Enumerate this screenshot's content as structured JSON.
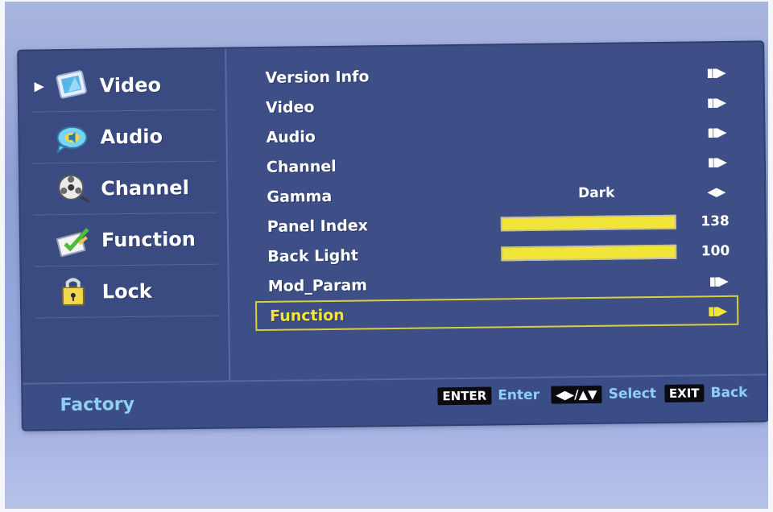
{
  "sidebar": {
    "items": [
      {
        "label": "Video",
        "icon": "video-icon",
        "selected": true
      },
      {
        "label": "Audio",
        "icon": "audio-icon",
        "selected": false
      },
      {
        "label": "Channel",
        "icon": "channel-icon",
        "selected": false
      },
      {
        "label": "Function",
        "icon": "function-icon",
        "selected": false
      },
      {
        "label": "Lock",
        "icon": "lock-icon",
        "selected": false
      }
    ]
  },
  "menu": {
    "rows": [
      {
        "label": "Version Info",
        "type": "submenu"
      },
      {
        "label": "Video",
        "type": "submenu"
      },
      {
        "label": "Audio",
        "type": "submenu"
      },
      {
        "label": "Channel",
        "type": "submenu"
      },
      {
        "label": "Gamma",
        "type": "option",
        "value": "Dark"
      },
      {
        "label": "Panel Index",
        "type": "slider",
        "value": "138"
      },
      {
        "label": "Back Light",
        "type": "slider",
        "value": "100"
      },
      {
        "label": "Mod_Param",
        "type": "submenu"
      },
      {
        "label": "Function",
        "type": "submenu",
        "selected": true
      }
    ]
  },
  "footer": {
    "title": "Factory",
    "enter_key": "ENTER",
    "enter_text": "Enter",
    "select_key": "◀▶/▲▼",
    "select_text": "Select",
    "exit_key": "EXIT",
    "exit_text": "Back"
  },
  "colors": {
    "panel": "#3d4f86",
    "highlight": "#f2e53a",
    "hint": "#8fd0f2"
  }
}
